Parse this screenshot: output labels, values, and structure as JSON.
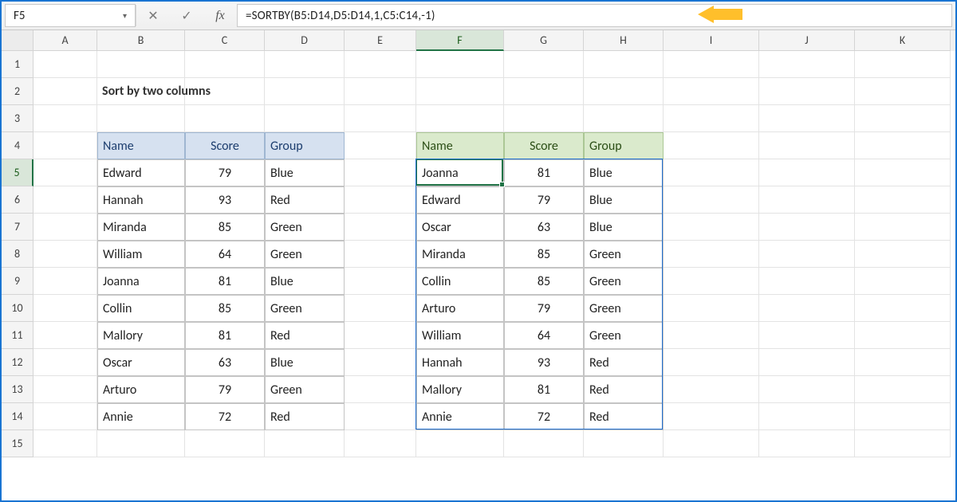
{
  "name_box": "F5",
  "formula": "=SORTBY(B5:D14,D5:D14,1,C5:C14,-1)",
  "columns": [
    "A",
    "B",
    "C",
    "D",
    "E",
    "F",
    "G",
    "H",
    "I",
    "J",
    "K"
  ],
  "active_col": "F",
  "row_count": 15,
  "active_row": 5,
  "title": "Sort by two columns",
  "left_table": {
    "headers": [
      "Name",
      "Score",
      "Group"
    ],
    "rows": [
      [
        "Edward",
        "79",
        "Blue"
      ],
      [
        "Hannah",
        "93",
        "Red"
      ],
      [
        "Miranda",
        "85",
        "Green"
      ],
      [
        "William",
        "64",
        "Green"
      ],
      [
        "Joanna",
        "81",
        "Blue"
      ],
      [
        "Collin",
        "85",
        "Green"
      ],
      [
        "Mallory",
        "81",
        "Red"
      ],
      [
        "Oscar",
        "63",
        "Blue"
      ],
      [
        "Arturo",
        "79",
        "Green"
      ],
      [
        "Annie",
        "72",
        "Red"
      ]
    ]
  },
  "right_table": {
    "headers": [
      "Name",
      "Score",
      "Group"
    ],
    "rows": [
      [
        "Joanna",
        "81",
        "Blue"
      ],
      [
        "Edward",
        "79",
        "Blue"
      ],
      [
        "Oscar",
        "63",
        "Blue"
      ],
      [
        "Miranda",
        "85",
        "Green"
      ],
      [
        "Collin",
        "85",
        "Green"
      ],
      [
        "Arturo",
        "79",
        "Green"
      ],
      [
        "William",
        "64",
        "Green"
      ],
      [
        "Hannah",
        "93",
        "Red"
      ],
      [
        "Mallory",
        "81",
        "Red"
      ],
      [
        "Annie",
        "72",
        "Red"
      ]
    ]
  },
  "icons": {
    "caret": "▾",
    "cancel": "✕",
    "confirm": "✓",
    "fx": "fx"
  }
}
